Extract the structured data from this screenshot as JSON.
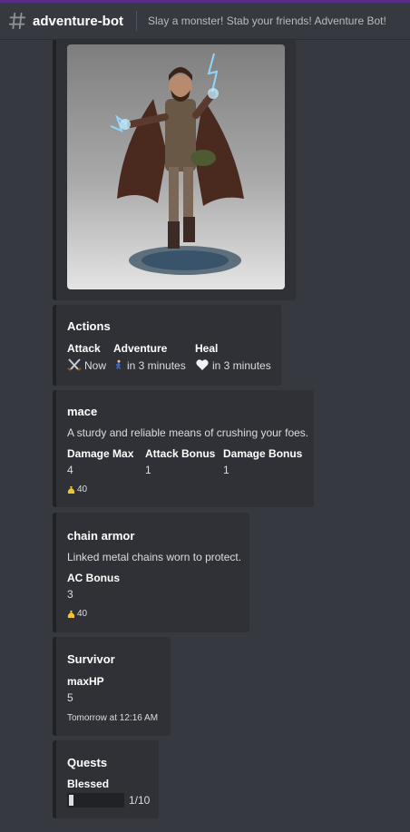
{
  "header": {
    "channel_name": "adventure-bot",
    "topic": "Slay a monster! Stab your friends! Adventure Bot!"
  },
  "hero_image": {
    "icon": "character-portrait-image"
  },
  "actions": {
    "title": "Actions",
    "items": [
      {
        "name": "Attack",
        "icon": "crossed-swords-icon",
        "value": "Now"
      },
      {
        "name": "Adventure",
        "icon": "walking-person-icon",
        "value": "in 3 minutes"
      },
      {
        "name": "Heal",
        "icon": "white-heart-icon",
        "value": "in 3 minutes"
      }
    ]
  },
  "mace": {
    "title": "mace",
    "description": "A sturdy and reliable means of crushing your foes.",
    "fields": [
      {
        "name": "Damage Max",
        "value": "4"
      },
      {
        "name": "Attack Bonus",
        "value": "1"
      },
      {
        "name": "Damage Bonus",
        "value": "1"
      }
    ],
    "cost": "40"
  },
  "chain_armor": {
    "title": "chain armor",
    "description": "Linked metal chains worn to protect.",
    "fields": [
      {
        "name": "AC Bonus",
        "value": "3"
      }
    ],
    "cost": "40"
  },
  "survivor": {
    "title": "Survivor",
    "field_name": "maxHP",
    "field_value": "5",
    "footer": "Tomorrow at 12:16 AM"
  },
  "quests": {
    "title": "Quests",
    "quest_name": "Blessed",
    "progress_text": "1/10",
    "progress_fraction": 0.1
  },
  "colors": {
    "background": "#36393f",
    "embed_background": "#2f3136",
    "embed_border": "#202225",
    "header_accent": "#5b2a86",
    "coin": "#f4c430"
  }
}
